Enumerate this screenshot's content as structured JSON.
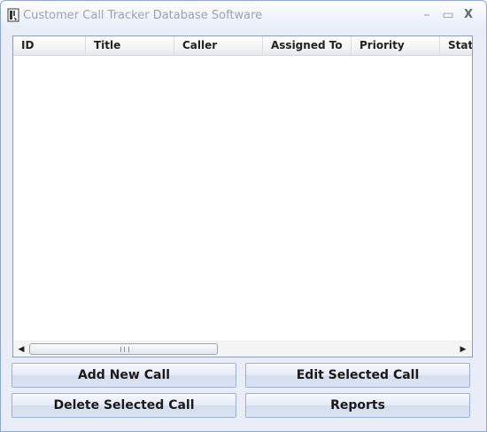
{
  "window": {
    "title": "Customer Call Tracker Database Software",
    "controls": {
      "minimize": "–",
      "maximize": "▭",
      "close": "X"
    }
  },
  "listview": {
    "columns": [
      "ID",
      "Title",
      "Caller",
      "Assigned To",
      "Priority",
      "Status"
    ],
    "rows": [],
    "scrollbar": {
      "left_arrow": "◀",
      "right_arrow": "▶"
    }
  },
  "buttons": {
    "add": "Add New Call",
    "edit": "Edit Selected Call",
    "delete": "Delete Selected Call",
    "reports": "Reports"
  },
  "colors": {
    "titlebar": "#e6ecf8",
    "button_border": "#9db0cf",
    "window_bg": "#e8edf7"
  }
}
